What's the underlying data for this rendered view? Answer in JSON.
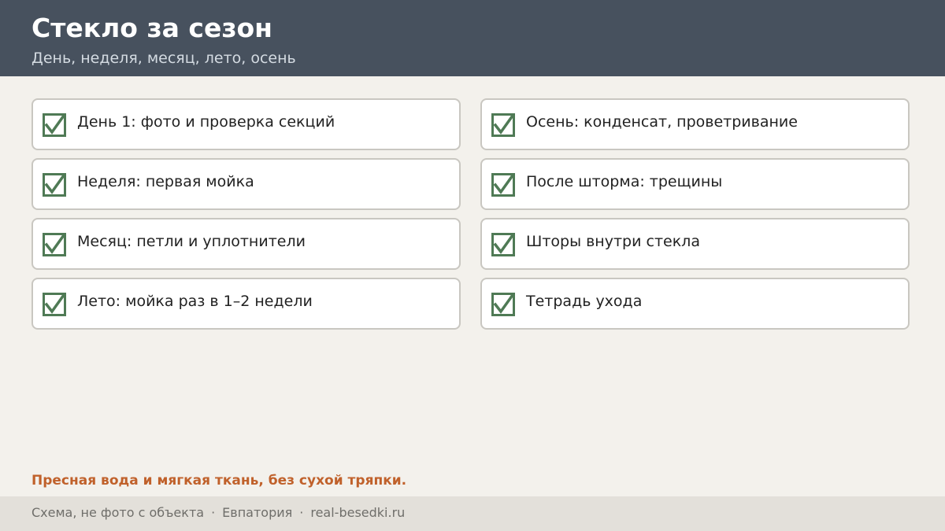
{
  "header": {
    "title": "Стекло за сезон",
    "subtitle": "День, неделя, месяц, лето, осень"
  },
  "checklist": {
    "left": [
      {
        "label": "День 1: фото и проверка секций",
        "checked": true
      },
      {
        "label": "Неделя: первая мойка",
        "checked": true
      },
      {
        "label": "Месяц: петли и уплотнители",
        "checked": true
      },
      {
        "label": "Лето: мойка раз в 1–2 недели",
        "checked": true
      }
    ],
    "right": [
      {
        "label": "Осень: конденсат, проветривание",
        "checked": true
      },
      {
        "label": "После шторма: трещины",
        "checked": true
      },
      {
        "label": "Шторы внутри стекла",
        "checked": true
      },
      {
        "label": "Тетрадь ухода",
        "checked": true
      }
    ]
  },
  "note": "Пресная вода и мягкая ткань, без сухой тряпки.",
  "footer": {
    "items": [
      "Схема, не фото с объекта",
      "Евпатория",
      "real-besedki.ru"
    ],
    "separator": "·"
  },
  "colors": {
    "header_bg": "#47515e",
    "check": "#4f7a55",
    "accent_note": "#c0612b",
    "page_bg": "#f3f1ec"
  },
  "icons": {
    "check": "checkbox-checked-icon"
  }
}
